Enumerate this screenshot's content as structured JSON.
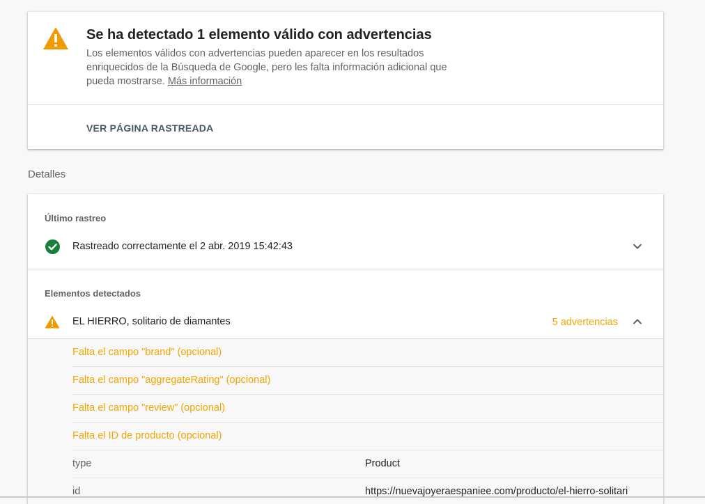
{
  "summary": {
    "title": "Se ha detectado 1 elemento válido con advertencias",
    "description": "Los elementos válidos con advertencias pueden aparecer en los resultados enriquecidos de la Búsqueda de Google, pero les falta información adicional que pueda mostrarse.",
    "more_info_link": "Más información",
    "view_crawled_button": "VER PÁGINA RASTREADA",
    "icon": "warning-icon",
    "warning_color": "#f29900"
  },
  "details": {
    "heading": "Detalles",
    "last_crawl": {
      "label": "Último rastreo",
      "status_text": "Rastreado correctamente el 2 abr. 2019 15:42:43",
      "icon": "check-circle-icon",
      "success_color": "#188038"
    },
    "detected_items": {
      "label": "Elementos detectados",
      "item_name": "EL HIERRO, solitario de diamantes",
      "warnings_count": "5 advertencias",
      "warning_text_color": "#f2a600",
      "warnings": [
        "Falta el campo \"brand\" (opcional)",
        "Falta el campo \"aggregateRating\" (opcional)",
        "Falta el campo \"review\" (opcional)",
        "Falta el ID de producto (opcional)"
      ],
      "properties": [
        {
          "key": "type",
          "value": "Product"
        },
        {
          "key": "id",
          "value": "https://nuevajoyeraespaniee.com/producto/el-hierro-solitari"
        }
      ]
    }
  }
}
